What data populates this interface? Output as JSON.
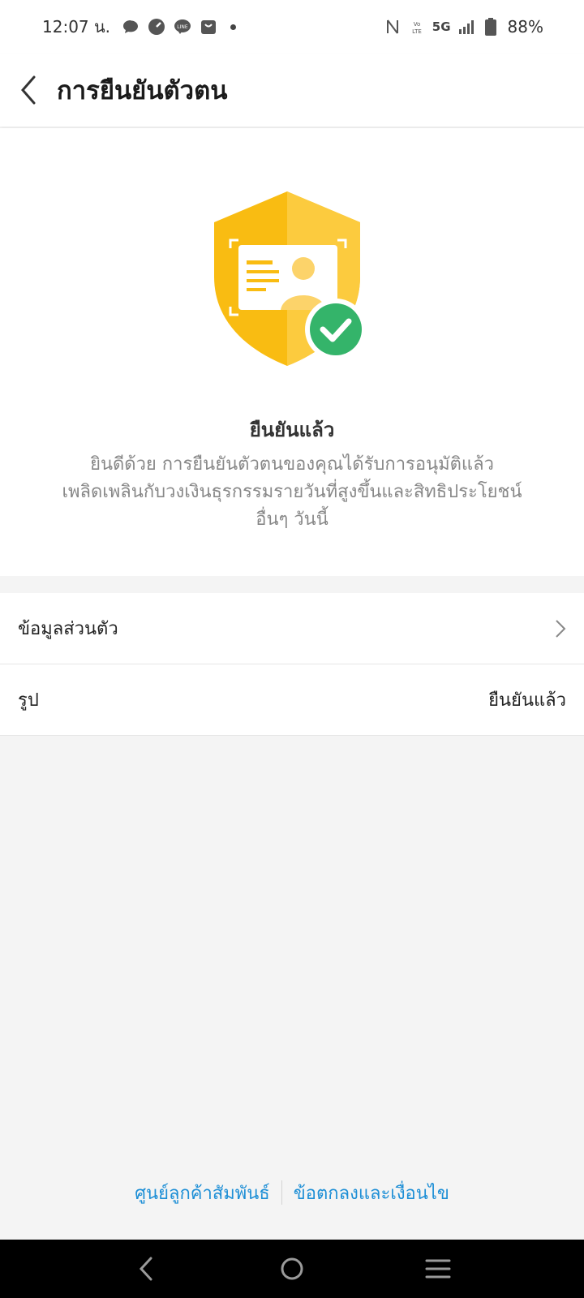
{
  "status_bar": {
    "time": "12:07 น.",
    "network": "5G",
    "volte": "VoLTE",
    "battery": "88%"
  },
  "header": {
    "title": "การยืนยันตัวตน",
    "back_icon": "chevron-left-icon"
  },
  "hero": {
    "status_title": "ยืนยันแล้ว",
    "description": "ยินดีด้วย การยืนยันตัวตนของคุณได้รับการอนุมัติแล้ว เพลิดเพลินกับวงเงินธุรกรรมรายวันที่สูงขึ้นและสิทธิประโยชน์อื่นๆ วันนี้",
    "colors": {
      "shield": "#F9BC12",
      "shield_light": "#FCCB3E",
      "check": "#34B46A"
    }
  },
  "list": {
    "personal_info_label": "ข้อมูลส่วนตัว",
    "photo_label": "รูป",
    "photo_status": "ยืนยันแล้ว"
  },
  "footer": {
    "customer_service": "ศูนย์ลูกค้าสัมพันธ์",
    "terms": "ข้อตกลงและเงื่อนไข",
    "link_color": "#1E8FD6"
  },
  "nav": {
    "back": "nav-back-icon",
    "home": "nav-home-icon",
    "recents": "nav-recents-icon"
  }
}
